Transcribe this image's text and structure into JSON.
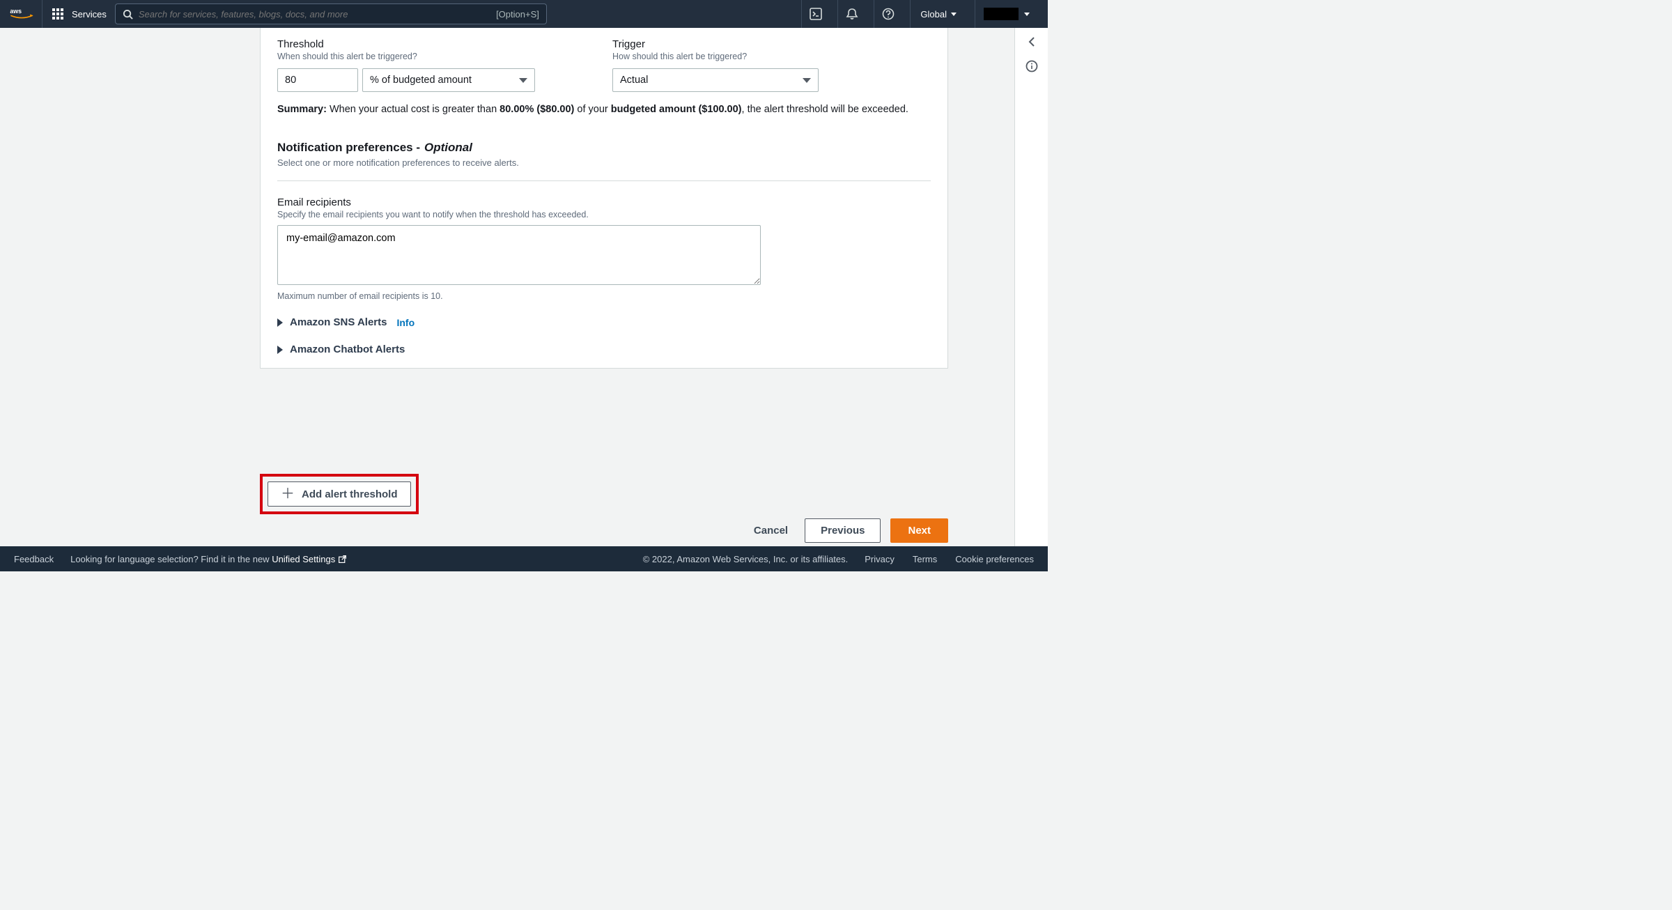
{
  "topnav": {
    "services_label": "Services",
    "search_placeholder": "Search for services, features, blogs, docs, and more",
    "shortcut": "[Option+S]",
    "region": "Global"
  },
  "threshold": {
    "label": "Threshold",
    "desc": "When should this alert be triggered?",
    "value": "80",
    "unit_select": "% of budgeted amount"
  },
  "trigger": {
    "label": "Trigger",
    "desc": "How should this alert be triggered?",
    "select": "Actual"
  },
  "summary": {
    "prefix": "Summary:",
    "p1": " When your actual cost is greater than ",
    "b1": "80.00% ($80.00)",
    "p2": " of your ",
    "b2": "budgeted amount ($100.00)",
    "p3": ", the alert threshold will be exceeded."
  },
  "notif": {
    "head": "Notification preferences - ",
    "opt": "Optional",
    "sub": "Select one or more notification preferences to receive alerts."
  },
  "email": {
    "label": "Email recipients",
    "desc": "Specify the email recipients you want to notify when the threshold has exceeded.",
    "value": "my-email@amazon.com",
    "hint": "Maximum number of email recipients is 10."
  },
  "expandos": {
    "sns": "Amazon SNS Alerts",
    "sns_info": "Info",
    "chatbot": "Amazon Chatbot Alerts"
  },
  "add_btn": "Add alert threshold",
  "actions": {
    "cancel": "Cancel",
    "previous": "Previous",
    "next": "Next"
  },
  "footer": {
    "feedback": "Feedback",
    "lang_prompt": "Looking for language selection? Find it in the new",
    "unified": "Unified Settings",
    "copyright": "© 2022, Amazon Web Services, Inc. or its affiliates.",
    "privacy": "Privacy",
    "terms": "Terms",
    "cookies": "Cookie preferences"
  }
}
